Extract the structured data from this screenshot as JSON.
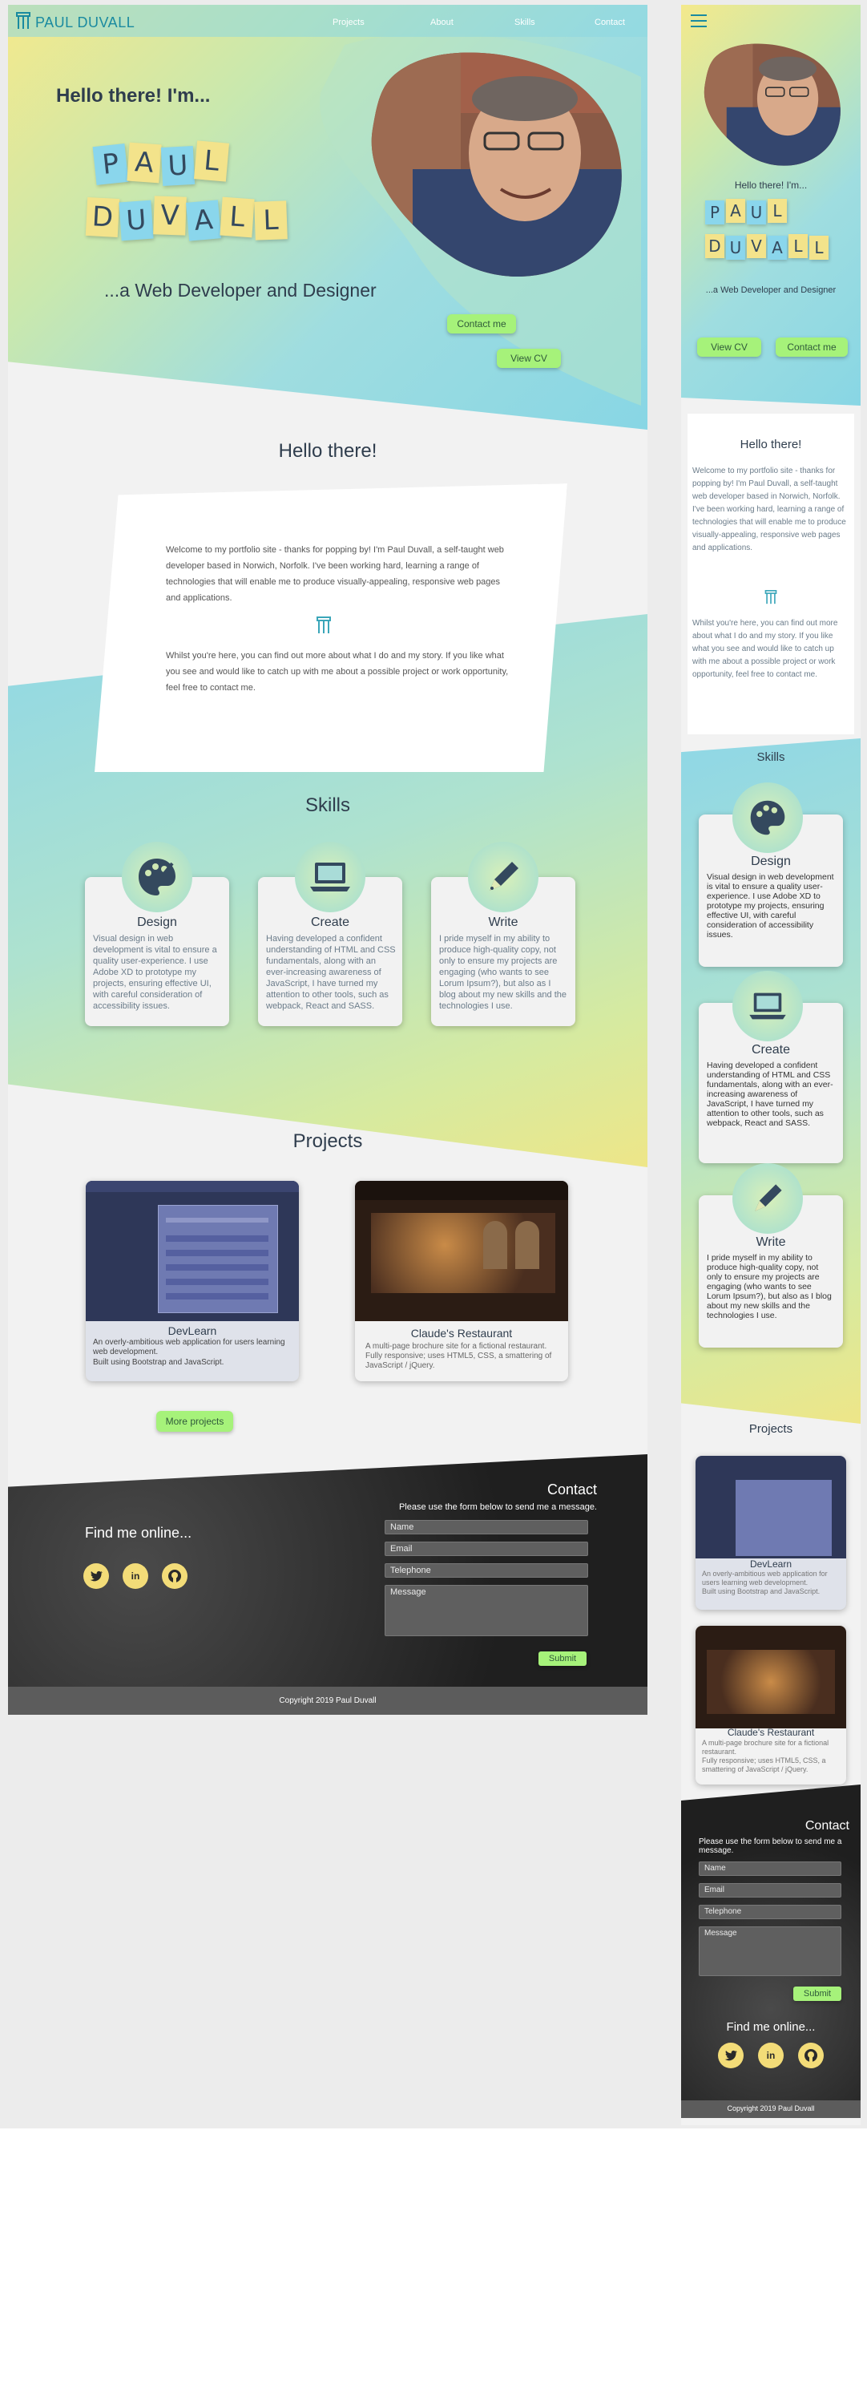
{
  "desktop": {
    "brand": "PAUL DUVALL",
    "nav": [
      "Projects",
      "About",
      "Skills",
      "Contact"
    ],
    "hero": {
      "greeting": "Hello there! I'm...",
      "name_line1": [
        "P",
        "A",
        "U",
        "L"
      ],
      "name_line2": [
        "D",
        "U",
        "V",
        "A",
        "L",
        "L"
      ],
      "tagline": "...a Web Developer and Designer",
      "contact_btn": "Contact me",
      "cv_btn": "View CV"
    },
    "about": {
      "title": "Hello there!",
      "p1": "Welcome to my portfolio site - thanks for popping by! I'm Paul Duvall, a self-taught web developer based in Norwich, Norfolk. I've been working hard, learning a range of technologies that will enable me to produce visually-appealing, responsive web pages and applications.",
      "p2": "Whilst you're here, you can find out more about what I do and my story. If you like what you see and would like to catch up with me about a possible project or work opportunity, feel free to contact me."
    },
    "skills": {
      "title": "Skills",
      "items": [
        {
          "icon": "palette-icon",
          "title": "Design",
          "text": "Visual design in web development is vital to ensure a quality user-experience. I use Adobe XD to prototype my projects, ensuring effective UI, with careful consideration of accessibility issues."
        },
        {
          "icon": "laptop-icon",
          "title": "Create",
          "text": "Having developed a confident understanding of HTML and CSS fundamentals, along with an ever-increasing awareness of JavaScript, I have turned my attention to other tools, such as webpack, React and SASS."
        },
        {
          "icon": "pen-icon",
          "title": "Write",
          "text": "I pride myself in my ability to produce high-quality copy, not only to ensure my projects are engaging (who wants to see Lorum Ipsum?), but also as I blog about my new skills and the technologies I use."
        }
      ]
    },
    "projects": {
      "title": "Projects",
      "items": [
        {
          "title": "DevLearn",
          "text": "An overly-ambitious web application for users learning web development.",
          "sub": "Built using Bootstrap and JavaScript."
        },
        {
          "title": "Claude's Restaurant",
          "text": "A multi-page brochure site for a fictional restaurant. Fully responsive; uses HTML5, CSS, a smattering of JavaScript / jQuery.",
          "sub": ""
        }
      ],
      "more_btn": "More projects"
    },
    "contact": {
      "title": "Contact",
      "intro": "Please use the form below to send me a message.",
      "name": "Name",
      "email": "Email",
      "phone": "Telephone",
      "message": "Message",
      "submit": "Submit",
      "find": "Find me online..."
    },
    "copyright": "Copyright 2019 Paul Duvall"
  },
  "mobile": {
    "greeting": "Hello there! I'm...",
    "tagline": "...a Web Developer and Designer",
    "cv_btn": "View CV",
    "contact_btn": "Contact me",
    "about_title": "Hello there!",
    "p1": "Welcome to my portfolio site - thanks for popping by! I'm Paul Duvall, a self-taught web developer based in Norwich, Norfolk. I've been working hard, learning a range of technologies that will enable me to produce visually-appealing, responsive web pages and applications.",
    "p2": "Whilst you're here, you can find out more about what I do and my story. If you like what you see and would like to catch up with me about a possible project or work opportunity, feel free to contact me.",
    "skills_title": "Skills",
    "projects_title": "Projects",
    "p_text1": "An overly-ambitious web application for users learning web development.",
    "p_sub1": "Built using Bootstrap and JavaScript.",
    "p_text2": "A multi-page brochure site for a fictional restaurant.",
    "p_sub2": "Fully responsive; uses HTML5, CSS, a smattering of JavaScript / jQuery.",
    "contact_intro": "Please use the form below to send me a message.",
    "copyright": "Copyright 2019 Paul Duvall"
  },
  "colors": {
    "accent": "#a6f27a",
    "tile_yellow": "#f3e38b",
    "tile_blue": "#8ad6ec",
    "footer": "#2a2a2a",
    "social": "#f3dc78"
  }
}
